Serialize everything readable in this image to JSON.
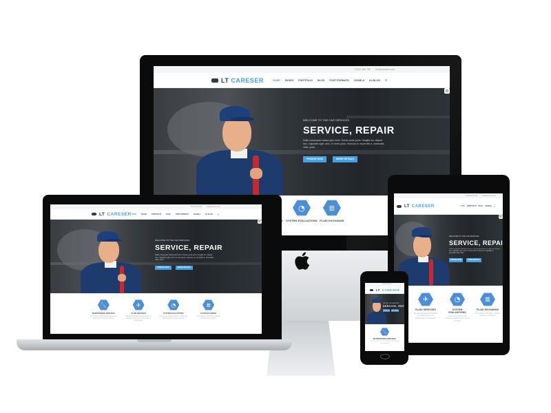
{
  "site": {
    "brand_prefix": "LT",
    "brand_name": "CARESER",
    "phone": "+0123 456 789",
    "email": "info@careser.com",
    "nav": [
      "HOME",
      "PAGES",
      "PORTFOLIO",
      "BLOG",
      "POST FORMATS",
      "JOOMLA",
      "K2 BLOG"
    ],
    "menu_icon": "hamburger-icon",
    "hero": {
      "kicker": "WELCOME TO THE CAR SERVICES",
      "headline": "SERVICE, REPAIR",
      "description": "Nulla consequat massa quis enim. Donec pede justo, fringilla vel, aliquet nec, vulputate eget, arcu. In enim justo, rhoncus ut, imperdiet a, venenatis vitae, justo.",
      "btn_primary": "PRICING NOW",
      "btn_secondary": "MORE DETAILS"
    },
    "services": [
      {
        "title": "MAINTENANCE SERVICES",
        "icon": "wrench-icon",
        "glyph": "🔧",
        "text": "Lorem ipsum dolor sit amet consectetur adipiscing elit sed do eiusmod."
      },
      {
        "title": "FLUID SERVICES",
        "icon": "rocket-icon",
        "glyph": "✈",
        "text": "Big data and advanced analytics are making profits more opportunities for businesses."
      },
      {
        "title": "SYSTEM EVALUATIONS",
        "icon": "dashboard-icon",
        "glyph": "◔",
        "text": "Lorem ipsum dolor sit amet, consectetur adipiscing elit, sed do eiusmod."
      },
      {
        "title": "FLUID EXCHANGE",
        "icon": "document-icon",
        "glyph": "≣",
        "text": "True platform that offers customer interaction at a glance."
      }
    ],
    "settings_icon": "gear-icon",
    "settings_glyph": "⚙"
  },
  "devices": {
    "desktop_logo": "apple-logo",
    "colors": {
      "accent": "#45a1e2",
      "hex_icon": "#4d8fd6",
      "device_frame": "#0c0c0c",
      "aluminium": "#d6d8db"
    }
  }
}
